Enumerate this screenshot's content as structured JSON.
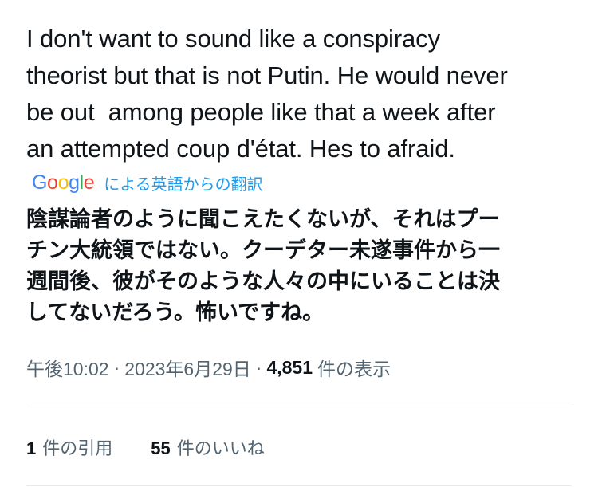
{
  "tweet": {
    "original_text": "I don't want to sound like a conspiracy\ntheorist but that is not Putin. He would never\nbe out  among people like that a week after\nan attempted coup d'état. Hes to afraid.",
    "translation": {
      "google_letters": [
        "G",
        "o",
        "o",
        "g",
        "l",
        "e"
      ],
      "label": "による英語からの翻訳",
      "text": "陰謀論者のように聞こえたくないが、それはプー\nチン大統領ではない。クーデター未遂事件から一\n週間後、彼がそのような人々の中にいることは決\nしてないだろう。怖いですね。"
    },
    "meta": {
      "time": "午後10:02",
      "separator_1": "·",
      "date": "2023年6月29日",
      "separator_2": "·",
      "views_count": "4,851",
      "views_label": "件の表示"
    },
    "stats": {
      "quotes_count": "1",
      "quotes_label": "件の引用",
      "likes_count": "55",
      "likes_label": "件のいいね"
    }
  },
  "colors": {
    "text_primary": "#0f1419",
    "text_secondary": "#536471",
    "link_blue": "#1d9bf0",
    "divider": "#e7e9eb",
    "google_blue": "#4285f4",
    "google_red": "#ea4335",
    "google_yellow": "#fbbc05",
    "google_green": "#34a853"
  }
}
